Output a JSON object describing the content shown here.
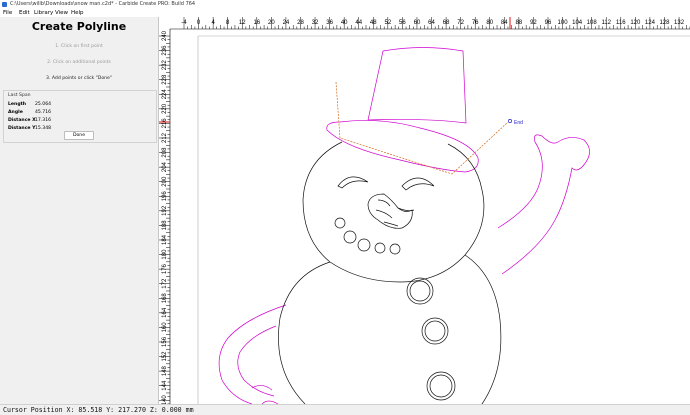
{
  "window": {
    "title": "C:\\Users\\willb\\Downloads\\snow man.c2d* - Carbide Create PRO: Build 764"
  },
  "menu": [
    "File",
    "Edit",
    "Library",
    "View",
    "Help"
  ],
  "panel": {
    "title": "Create Polyline",
    "step1": "1. Click on first point",
    "step2": "2. Click on additional points",
    "step3": "3. Add points or click \"Done\"",
    "last_span": {
      "title": "Last Span",
      "length_label": "Length",
      "length_value": "25.064",
      "angle_label": "Angle",
      "angle_value": "45.716",
      "dx_label": "Distance X",
      "dx_value": "17.316",
      "dy_label": "Distance Y",
      "dy_value": "15.348"
    },
    "done_label": "Done"
  },
  "ruler": {
    "x_labels": [
      "-4",
      "0",
      "4",
      "8",
      "12",
      "16",
      "20",
      "24",
      "28",
      "32",
      "36",
      "40",
      "44",
      "48",
      "52",
      "56",
      "60",
      "64",
      "68",
      "72",
      "76",
      "80",
      "84",
      "88",
      "92",
      "96",
      "100",
      "104",
      "108",
      "112",
      "116",
      "120",
      "124",
      "128",
      "132"
    ],
    "y_labels": [
      "240",
      "236",
      "232",
      "228",
      "224",
      "220",
      "216",
      "212",
      "208",
      "204",
      "200",
      "196",
      "192",
      "188",
      "184",
      "180",
      "176",
      "172",
      "168",
      "164",
      "160",
      "156",
      "152",
      "148",
      "144",
      "140"
    ]
  },
  "cursor_label": "End",
  "status": {
    "text": "Cursor Position X: 85.518 Y: 217.270 Z: 0.000 mm"
  },
  "colors": {
    "drawing": "#000000",
    "selected": "#d000d0",
    "polyline": "#d46a1a",
    "cursor": "#c00000",
    "endpoint": "#2222cc"
  }
}
